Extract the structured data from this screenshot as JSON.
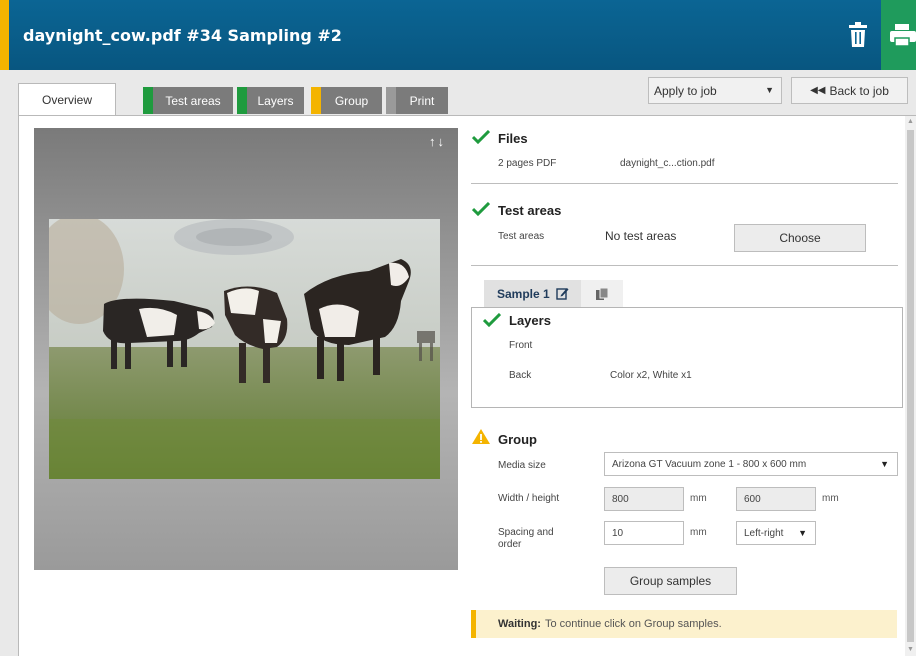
{
  "header": {
    "title": "daynight_cow.pdf #34 Sampling #2",
    "icons": [
      "trash-icon",
      "printer-icon"
    ]
  },
  "tabs": [
    {
      "label": "Overview",
      "status_color": null
    },
    {
      "label": "Test areas",
      "status_color": "#1f9b3e"
    },
    {
      "label": "Layers",
      "status_color": "#1f9b3e"
    },
    {
      "label": "Group",
      "status_color": "#f4b400"
    },
    {
      "label": "Print",
      "status_color": "#9a9a9a"
    }
  ],
  "toolbar": {
    "apply_select": "Apply to job",
    "back_label": "Back to job"
  },
  "files": {
    "title": "Files",
    "pages": "2 pages PDF",
    "filename": "daynight_c...ction.pdf"
  },
  "test_areas": {
    "title": "Test areas",
    "label": "Test areas",
    "value": "No test areas",
    "choose_label": "Choose"
  },
  "sample": {
    "tab_label": "Sample 1",
    "layers_title": "Layers",
    "front_label": "Front",
    "front_value": "",
    "back_label": "Back",
    "back_value": "Color x2, White x1"
  },
  "group": {
    "title": "Group",
    "media_size_label": "Media size",
    "media_size_value": "Arizona GT Vacuum zone 1 - 800 x 600 mm",
    "width_height_label": "Width / height",
    "width_value": "800",
    "height_value": "600",
    "unit": "mm",
    "spacing_label": "Spacing and order",
    "spacing_value": "10",
    "order_value": "Left-right",
    "group_button_label": "Group samples"
  },
  "status": {
    "label": "Waiting:",
    "message": "To continue click on Group samples."
  },
  "colors": {
    "header_blue": "#085680",
    "accent_yellow": "#f4b400",
    "ok_green": "#1f9b3e",
    "print_green": "#1f9b5c"
  }
}
